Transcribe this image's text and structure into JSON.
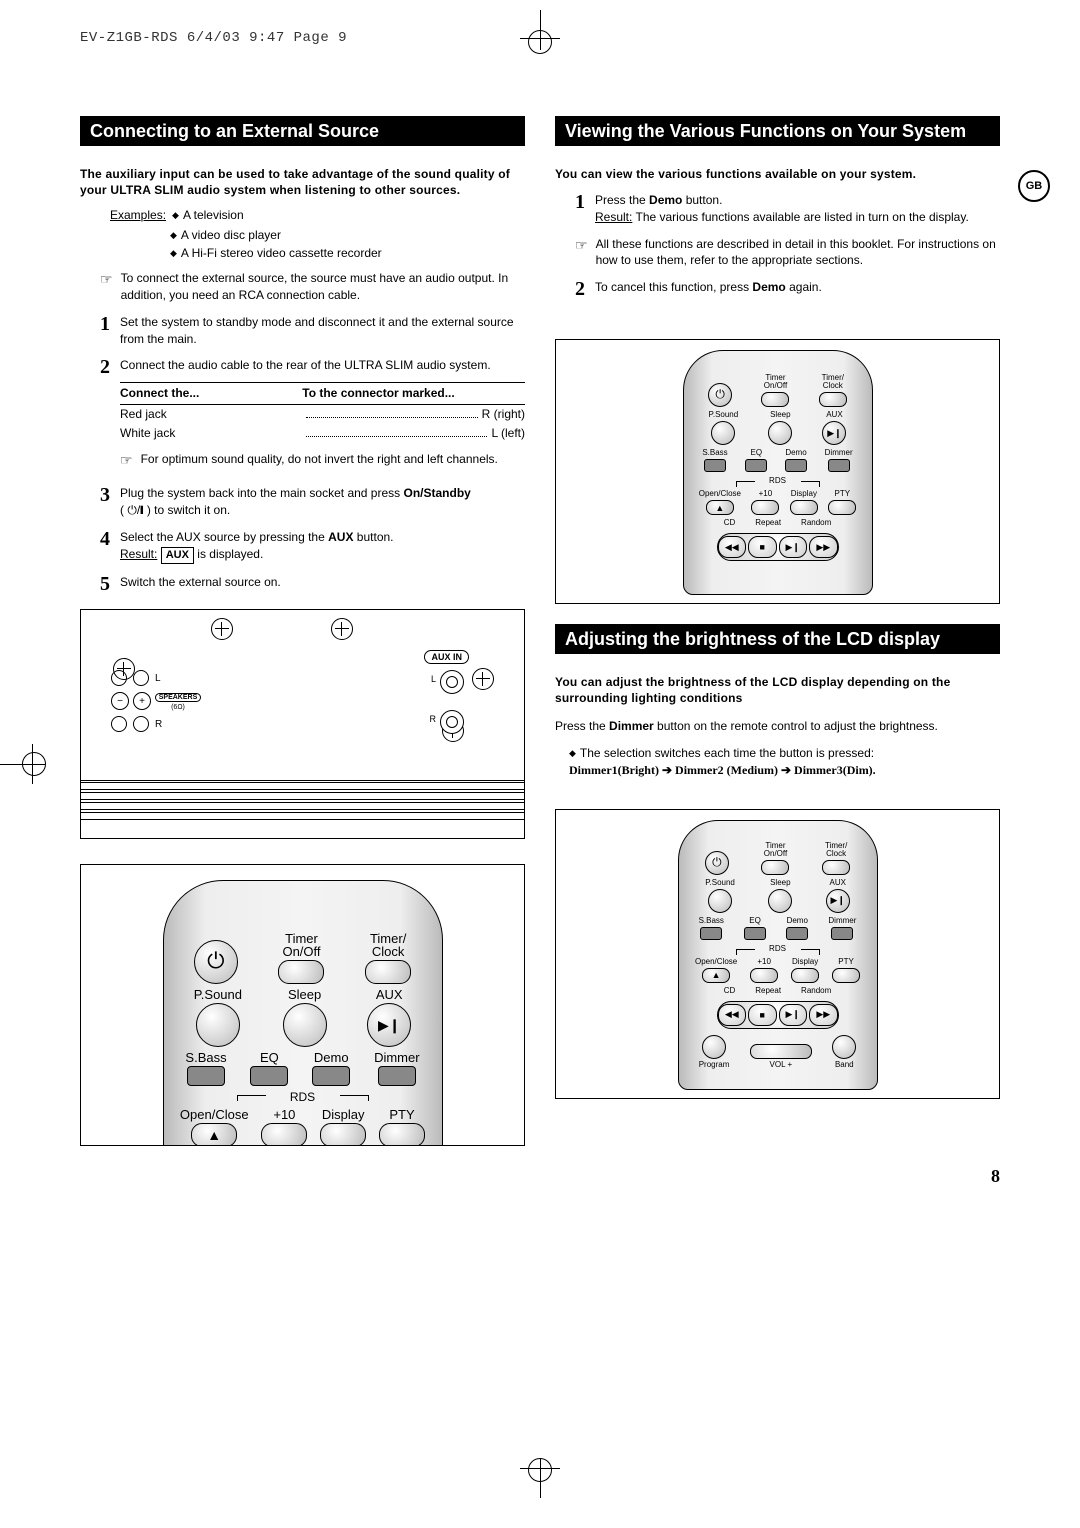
{
  "print_header": "EV-Z1GB-RDS  6/4/03 9:47  Page 9",
  "gb_badge": "GB",
  "page_number": "8",
  "left": {
    "title": "Connecting to an External Source",
    "intro": "The auxiliary input can be used to take advantage of the sound quality of your ULTRA SLIM audio system when listening to other sources.",
    "examples_label": "Examples:",
    "examples": [
      "A television",
      "A video disc player",
      "A Hi-Fi stereo video cassette recorder"
    ],
    "pointer": "To connect the external source, the source must have an audio output. In addition, you need an RCA connection cable.",
    "steps": {
      "s1": "Set the system to standby mode and disconnect it and the external source from the main.",
      "s2": "Connect the audio cable to the rear of the ULTRA SLIM audio system.",
      "conn_head_left": "Connect the...",
      "conn_head_right": "To the connector marked...",
      "conn_rows": [
        {
          "l": "Red jack",
          "r": "R (right)"
        },
        {
          "l": "White jack",
          "r": "L (left)"
        }
      ],
      "s2_note": "For optimum sound quality, do not invert the right and left channels.",
      "s3a": "Plug the system back into the main socket and press ",
      "s3b": "On/Standby",
      "s3c": " (       ) to switch it on.",
      "s4a": "Select the AUX source by pressing the ",
      "s4b": "AUX",
      "s4c": " button.",
      "s4_result_label": "Result:",
      "s4_result_box": "AUX",
      "s4_result_tail": " is displayed.",
      "s5": "Switch the external source on."
    },
    "panel": {
      "aux_in": "AUX IN",
      "speakers": "SPEAKERS",
      "ohm": "(6Ω)",
      "L": "L",
      "R": "R"
    }
  },
  "right": {
    "title1": "Viewing the Various Functions on Your System",
    "intro1": "You can view the various functions available on your system.",
    "s1a": "Press the ",
    "s1b": "Demo",
    "s1c": " button.",
    "s1_result_label": "Result:",
    "s1_result": "The various functions available are listed in turn on the display.",
    "pointer1": "All these functions are described in detail in this booklet. For instructions on how to use them, refer to the appropriate sections.",
    "s2a": "To cancel this function, press ",
    "s2b": "Demo",
    "s2c": " again.",
    "title2": "Adjusting the brightness of the LCD display",
    "intro2": "You can adjust the brightness of the LCD display depending on the surrounding lighting conditions",
    "body2a": "Press the ",
    "body2b": "Dimmer",
    "body2c": " button on the remote control to adjust the brightness.",
    "bullet2": "The selection switches each time the button is pressed:",
    "sequence": "Dimmer1(Bright) ➔ Dimmer2 (Medium) ➔ Dimmer3(Dim)."
  },
  "remote": {
    "power": "⏻",
    "timer_onoff": "Timer\nOn/Off",
    "timer_clock": "Timer/\nClock",
    "psound": "P.Sound",
    "sleep": "Sleep",
    "aux": "AUX",
    "sbass": "S.Bass",
    "eq": "EQ",
    "demo": "Demo",
    "dimmer": "Dimmer",
    "openclose": "Open/Close",
    "plus10": "+10",
    "display": "Display",
    "pty": "PTY",
    "rds": "RDS",
    "cd": "CD",
    "repeat": "Repeat",
    "random": "Random",
    "program": "Program",
    "vol": "VOL +",
    "band": "Band",
    "eject": "▲"
  }
}
